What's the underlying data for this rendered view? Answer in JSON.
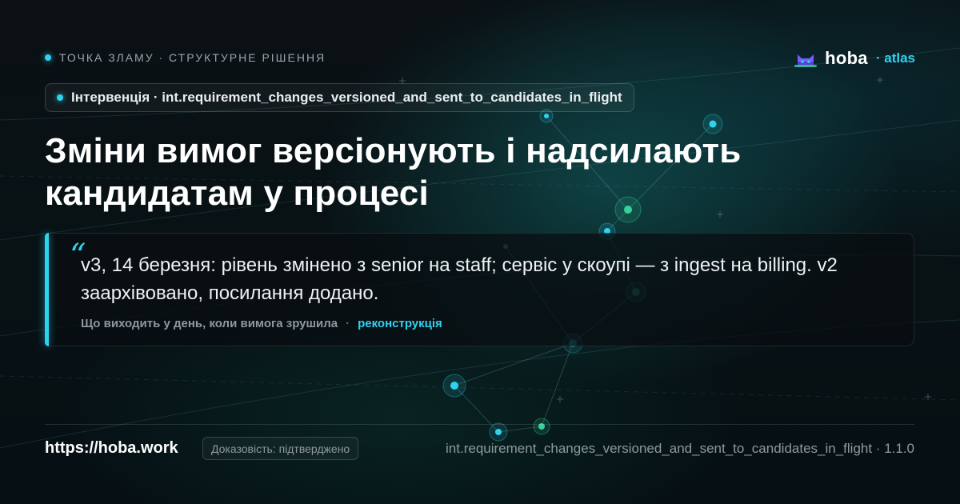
{
  "eyebrow": {
    "text": "ТОЧКА ЗЛАМУ · СТРУКТУРНЕ РІШЕННЯ"
  },
  "brand": {
    "name": "hoba",
    "sub": "· atlas",
    "logo_icon": "cat-icon"
  },
  "pill": {
    "label": "Інтервенція · int.requirement_changes_versioned_and_sent_to_candidates_in_flight"
  },
  "title": {
    "text": "Зміни вимог версіонують і надсилають кандидатам у процесі"
  },
  "quote": {
    "mark": "“",
    "text": "v3, 14 березня: рівень змінено з senior на staff; сервіс у скоупі — з ingest на billing. v2 заархівовано, посилання додано.",
    "source": "Що виходить у день, коли вимога зрушила",
    "separator": "·",
    "tag": "реконструкція"
  },
  "footer": {
    "url": "https://hoba.work",
    "badge": "Доказовість: підтверджено",
    "id": "int.requirement_changes_versioned_and_sent_to_candidates_in_flight · 1.1.0"
  },
  "colors": {
    "accent": "#2ed3f0",
    "accent_green": "#34d39a",
    "background": "#070b0d",
    "text_primary": "#ffffff",
    "text_muted": "#8e999e"
  }
}
